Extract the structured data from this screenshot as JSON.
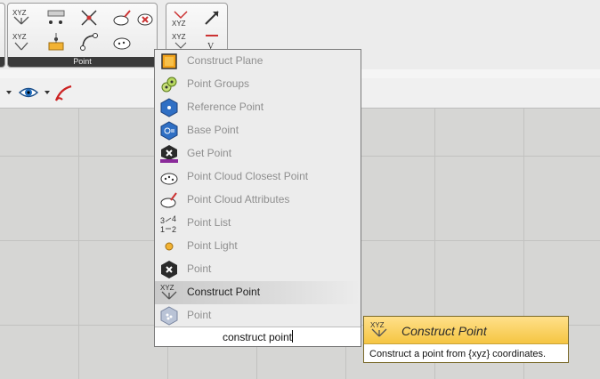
{
  "ribbon": {
    "panel_label": "Point"
  },
  "popup": {
    "items": [
      {
        "label": "Construct Plane",
        "icon": "construct-plane-icon",
        "selected": false
      },
      {
        "label": "Point Groups",
        "icon": "point-groups-icon",
        "selected": false
      },
      {
        "label": "Reference Point",
        "icon": "reference-point-icon",
        "selected": false
      },
      {
        "label": "Base Point",
        "icon": "base-point-icon",
        "selected": false
      },
      {
        "label": "Get Point",
        "icon": "get-point-icon",
        "selected": false
      },
      {
        "label": "Point Cloud Closest Point",
        "icon": "point-cloud-closest-point-icon",
        "selected": false
      },
      {
        "label": "Point Cloud Attributes",
        "icon": "point-cloud-attributes-icon",
        "selected": false
      },
      {
        "label": "Point List",
        "icon": "point-list-icon",
        "selected": false
      },
      {
        "label": "Point Light",
        "icon": "point-light-icon",
        "selected": false
      },
      {
        "label": "Point",
        "icon": "point-param-icon",
        "selected": false
      },
      {
        "label": "Construct Point",
        "icon": "construct-point-icon",
        "selected": true
      },
      {
        "label": "Point",
        "icon": "point-cloud-point-icon",
        "selected": false
      }
    ],
    "search_value": "construct point"
  },
  "tooltip": {
    "title": "Construct Point",
    "description": "Construct a point from {xyz} coordinates."
  },
  "colors": {
    "tooltip_header": "#f5c542",
    "selected_row": "#c9c9c9",
    "panel_footer": "#3a3a3a"
  }
}
